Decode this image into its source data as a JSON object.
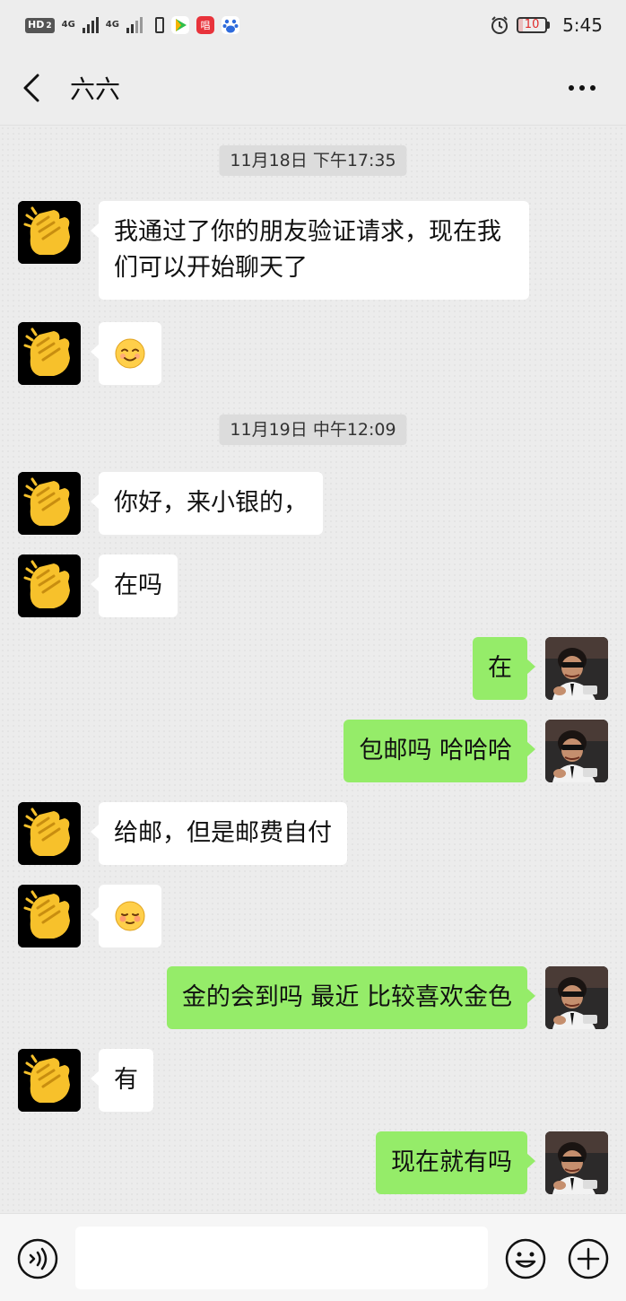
{
  "status_bar": {
    "hd_badge": "HD",
    "sim_index": "2",
    "network_1": "4G",
    "network_2": "4G",
    "app_badge": "唱",
    "battery_level": "10",
    "time": "5:45",
    "icons": [
      "hd-icon",
      "signal-icon",
      "signal-icon",
      "battery-saver-icon",
      "video-app-icon",
      "music-app-icon",
      "baidu-icon",
      "alarm-icon",
      "battery-icon"
    ]
  },
  "header": {
    "title": "六六",
    "back_icon": "chevron-left-icon",
    "more_icon": "more-icon"
  },
  "colors": {
    "my_bubble": "#95ec69",
    "their_bubble": "#ffffff",
    "background": "#ececec",
    "timestamp_bg": "#dcdcdc"
  },
  "messages": {
    "ts1": "11月18日 下午17:35",
    "m1": "我通过了你的朋友验证请求，现在我们可以开始聊天了",
    "m2_emoji": "smile-emoji",
    "ts2": "11月19日 中午12:09",
    "m3": "你好，来小银的，",
    "m4": "在吗",
    "m5": "在",
    "m6": "包邮吗 哈哈哈",
    "m7": "给邮，但是邮费自付",
    "m8_emoji": "shy-smile-emoji",
    "m9": "金的会到吗 最近 比较喜欢金色",
    "m10": "有",
    "m11": "现在就有吗"
  },
  "input_bar": {
    "text_value": "",
    "icons": [
      "voice-icon",
      "emoji-icon",
      "plus-icon"
    ]
  }
}
